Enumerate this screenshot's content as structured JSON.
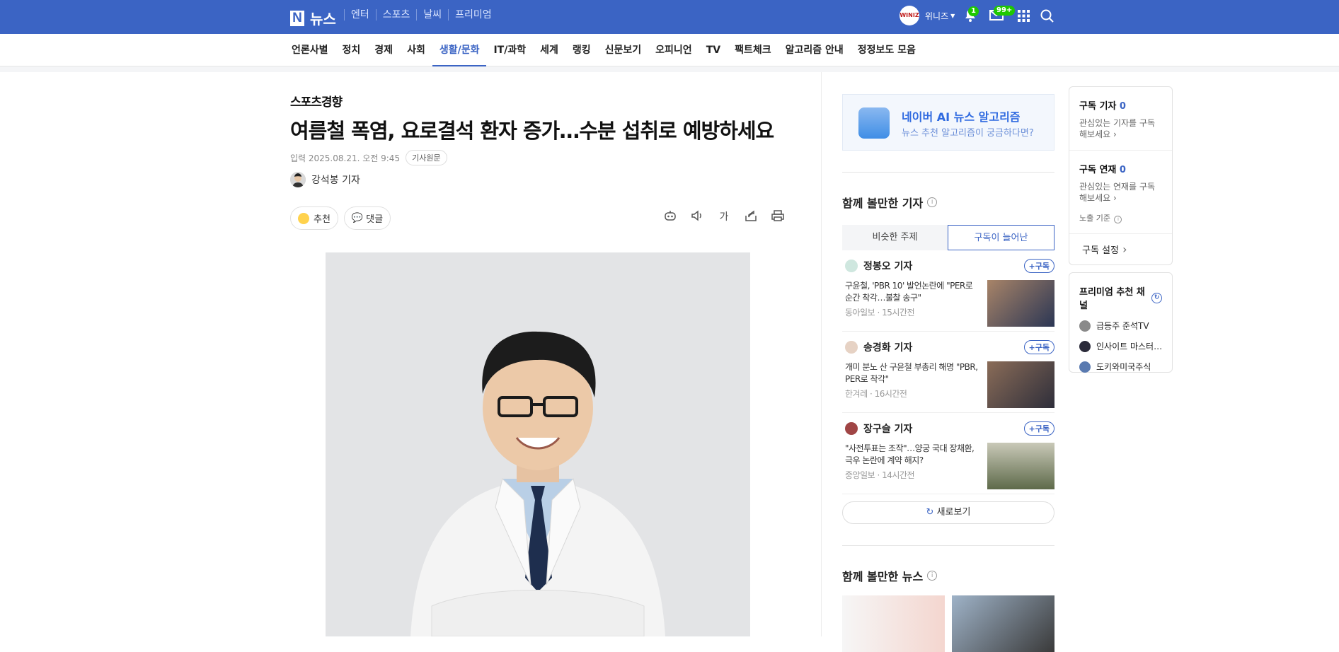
{
  "topbar": {
    "logo_letter": "N",
    "logo_text": "뉴스",
    "links": [
      "엔터",
      "스포츠",
      "날씨",
      "프리미엄"
    ],
    "user_avatar_text": "WINIZ",
    "user_name": "위니즈",
    "notification_count": "1",
    "mail_count": "99+"
  },
  "categories": [
    "언론사별",
    "정치",
    "경제",
    "사회",
    "생활/문화",
    "IT/과학",
    "세계",
    "랭킹",
    "신문보기",
    "오피니언",
    "TV",
    "팩트체크",
    "알고리즘 안내",
    "정정보도 모음"
  ],
  "active_category": "생활/문화",
  "article": {
    "press": "스포츠경향",
    "headline": "여름철 폭염, 요로결석 환자 증가…수분 섭취로 예방하세요",
    "date": "입력 2025.08.21. 오전 9:45",
    "original_label": "기사원문",
    "reporter": "강석봉 기자",
    "recommend_label": "추천",
    "comment_label": "댓글"
  },
  "ai_banner": {
    "title": "네이버 AI 뉴스 알고리즘",
    "subtitle": "뉴스 추천 알고리즘이 궁금하다면?"
  },
  "reporters_section": {
    "title": "함께 볼만한 기자",
    "tab_similar": "비슷한 주제",
    "tab_growing": "구독이 늘어난",
    "subscribe_label": "+구독",
    "items": [
      {
        "name": "정봉오 기자",
        "headline": "구윤철, 'PBR 10' 발언논란에 \"PER로 순간 착각…불찰 송구\"",
        "press": "동아일보",
        "time": "15시간전"
      },
      {
        "name": "송경화 기자",
        "headline": "개미 분노 산 구윤철 부총리 해명 \"PBR, PER로 착각\"",
        "press": "한겨레",
        "time": "16시간전"
      },
      {
        "name": "장구슬 기자",
        "headline": "\"사전투표는 조작\"…양궁 국대 장채환, 극우 논란에 계약 해지?",
        "press": "중앙일보",
        "time": "14시간전"
      }
    ],
    "refresh_label": "새로보기"
  },
  "news_section": {
    "title": "함께 볼만한 뉴스"
  },
  "subscribe_box": {
    "reporter_title": "구독 기자",
    "reporter_count": "0",
    "reporter_desc": "관심있는 기자를 구독해보세요",
    "series_title": "구독 연재",
    "series_count": "0",
    "series_desc": "관심있는 연재를 구독해보세요",
    "exposure_label": "노출 기준",
    "settings_label": "구독 설정"
  },
  "premium_box": {
    "title": "프리미엄 추천 채널",
    "channels": [
      "급등주 준석TV",
      "인사이트 마스터…",
      "도키와미국주식"
    ]
  },
  "colors": {
    "brand": "#3b64c4",
    "badge": "#1ec800"
  }
}
